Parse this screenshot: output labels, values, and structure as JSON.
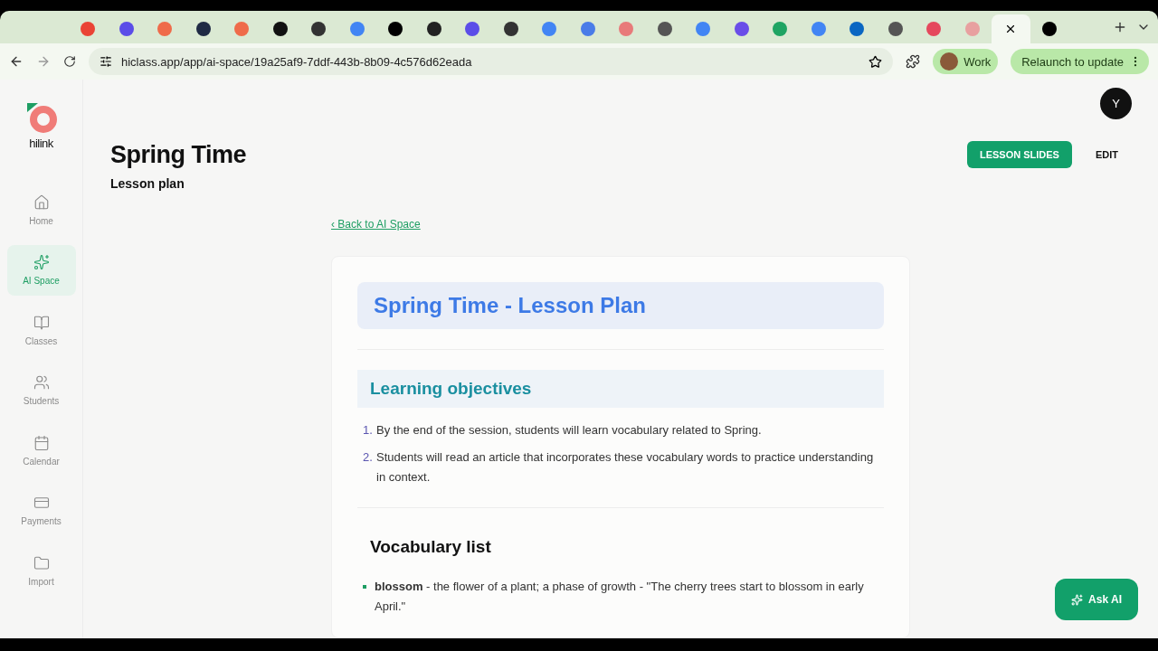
{
  "browser": {
    "tabs": [
      {
        "selected": false,
        "color": "#ea4335"
      },
      {
        "selected": false,
        "color": "#5b4de8"
      },
      {
        "selected": false,
        "color": "#ef6b4a"
      },
      {
        "selected": false,
        "color": "#1f2a44"
      },
      {
        "selected": false,
        "color": "#ef6b4a"
      },
      {
        "selected": false,
        "color": "#111111"
      },
      {
        "selected": false,
        "color": "#333333"
      },
      {
        "selected": false,
        "color": "#4285f4"
      },
      {
        "selected": false,
        "color": "#000000"
      },
      {
        "selected": false,
        "color": "#222222"
      },
      {
        "selected": false,
        "color": "#5b4de8"
      },
      {
        "selected": false,
        "color": "#333333"
      },
      {
        "selected": false,
        "color": "#4285f4"
      },
      {
        "selected": false,
        "color": "#4a7ce8"
      },
      {
        "selected": false,
        "color": "#e87a7a"
      },
      {
        "selected": false,
        "color": "#555555"
      },
      {
        "selected": false,
        "color": "#4285f4"
      },
      {
        "selected": false,
        "color": "#6a4de8"
      },
      {
        "selected": false,
        "color": "#1fa463"
      },
      {
        "selected": false,
        "color": "#4285f4"
      },
      {
        "selected": false,
        "color": "#0a66c2"
      },
      {
        "selected": false,
        "color": "#555555"
      },
      {
        "selected": false,
        "color": "#e5485d"
      },
      {
        "selected": false,
        "color": "#e8a0a0"
      },
      {
        "selected": true
      },
      {
        "selected": false,
        "color": "#000000"
      }
    ],
    "url": "hiclass.app/app/ai-space/19a25af9-7ddf-443b-8b09-4c576d62eada",
    "profile": "Work",
    "relaunch": "Relaunch to update"
  },
  "sidebar": {
    "logo": "hilink",
    "items": [
      {
        "label": "Home",
        "kind": "home",
        "selected": false
      },
      {
        "label": "AI Space",
        "kind": "sparkle",
        "selected": true
      },
      {
        "label": "Classes",
        "kind": "book",
        "selected": false
      },
      {
        "label": "Students",
        "kind": "people",
        "selected": false
      },
      {
        "label": "Calendar",
        "kind": "calendar",
        "selected": false
      },
      {
        "label": "Payments",
        "kind": "card",
        "selected": false
      },
      {
        "label": "Import",
        "kind": "folder",
        "selected": false
      }
    ]
  },
  "header": {
    "avatar": "Y",
    "title": "Spring Time",
    "subtitle": "Lesson plan",
    "buttons": [
      {
        "label": "LESSON SLIDES",
        "kind": "primary"
      },
      {
        "label": "EDIT",
        "kind": "plain"
      }
    ]
  },
  "back_link": "‹ Back to AI Space",
  "document": {
    "title": "Spring Time - Lesson Plan",
    "objectives": {
      "heading": "Learning objectives",
      "items": [
        {
          "number": "1.",
          "text": "By the end of the session, students will learn vocabulary related to Spring."
        },
        {
          "number": "2.",
          "text": "Students will read an article that incorporates these vocabulary words to practice understanding in context."
        }
      ]
    },
    "vocabulary": {
      "heading": "Vocabulary list",
      "items": [
        {
          "text": "**blossom** - the flower of a plant; a phase of growth - \"The cherry trees start to blossom in early April.\""
        }
      ]
    }
  },
  "ask_ai": "Ask AI"
}
